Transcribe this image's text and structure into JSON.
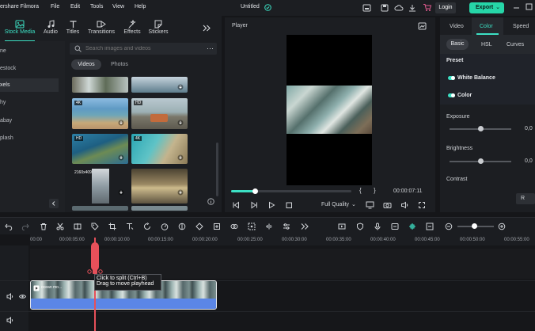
{
  "app": {
    "title": "Wondershare Filmora",
    "title_visible": "ershare Filmora",
    "project_name": "Untitled"
  },
  "menu": [
    "File",
    "Edit",
    "Tools",
    "View",
    "Help"
  ],
  "header": {
    "login_label": "Login",
    "export_label": "Export"
  },
  "media_tabs": [
    {
      "label": "Stock Media",
      "icon": "stock-media-icon",
      "active": true
    },
    {
      "label": "Audio",
      "icon": "music-note-icon"
    },
    {
      "label": "Titles",
      "icon": "text-icon"
    },
    {
      "label": "Transitions",
      "icon": "transitions-icon"
    },
    {
      "label": "Effects",
      "icon": "effects-icon"
    },
    {
      "label": "Stickers",
      "icon": "stickers-icon"
    }
  ],
  "sidebar": {
    "items": [
      {
        "label": "ne",
        "active": false
      },
      {
        "label": "estock",
        "active": false
      },
      {
        "label": "xels",
        "active": true
      },
      {
        "label": "hy",
        "active": false
      },
      {
        "label": "abay",
        "active": false
      },
      {
        "label": "plash",
        "active": false
      }
    ]
  },
  "media": {
    "search_placeholder": "Search images and videos",
    "filter_tabs": [
      "Videos",
      "Photos"
    ],
    "active_filter": "Videos",
    "thumb_badges": [
      "4K",
      "HD",
      "HD",
      "4K",
      "2160x4096"
    ]
  },
  "player": {
    "label": "Player",
    "timecode": "00:00:07:11",
    "progress": 0.2,
    "quality": "Full Quality",
    "brackets": [
      "{",
      "}"
    ]
  },
  "properties": {
    "tabs": [
      "Video",
      "Color",
      "Speed"
    ],
    "active_tab": "Color",
    "subtabs": [
      "Basic",
      "HSL",
      "Curves"
    ],
    "active_subtab": "Basic",
    "preset_label": "Preset",
    "white_balance_label": "White Balance",
    "color_label": "Color",
    "exposure": {
      "label": "Exposure",
      "value": "0,0",
      "level": 0.5
    },
    "brightness": {
      "label": "Brightness",
      "value": "0,0",
      "level": 0.5
    },
    "contrast_label": "Contrast",
    "reset_label": "R"
  },
  "timeline": {
    "ruler": [
      "00:00",
      "00:00:05:00",
      "00:00:10:00",
      "00:00:15:00",
      "00:00:20:00",
      "00:00:25:00",
      "00:00:30:00",
      "00:00:35:00",
      "00:00:40:00",
      "00:00:45:00",
      "00:00:50:00",
      "00:00:55:00"
    ],
    "tooltip": {
      "line1": "Click to split (Ctrl+B)",
      "line2": "Drag to move playhead"
    },
    "clip_label": "ocean mo..."
  },
  "colors": {
    "accent": "#3ce0c4",
    "export": "#26d6a8",
    "playhead": "#e6505a",
    "clip_audio": "#5b86e6",
    "background": "#151619"
  }
}
